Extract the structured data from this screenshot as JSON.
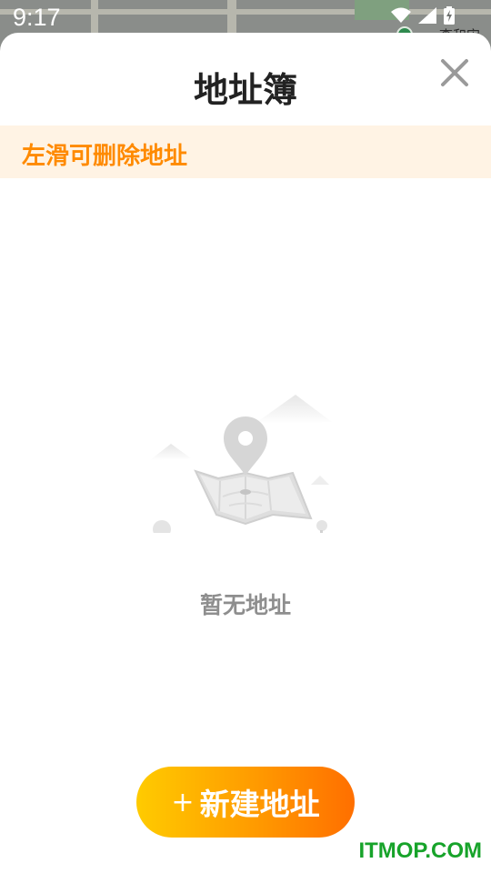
{
  "status_bar": {
    "time": "9:17",
    "icons": [
      "wifi-icon",
      "cellular-signal-icon",
      "battery-charging-icon"
    ]
  },
  "map_backdrop": {
    "label": "李和宋"
  },
  "sheet": {
    "title": "地址簿",
    "close_icon": "close-icon",
    "tip": "左滑可删除地址",
    "empty_state": {
      "icon": "map-location-illustration",
      "text": "暂无地址"
    },
    "new_button": {
      "plus": "+",
      "label": "新建地址"
    }
  },
  "watermark": "ITMOP.COM",
  "colors": {
    "accent_orange": "#ff8a00",
    "tip_background": "#fff3e4",
    "button_gradient_start": "#ffcb00",
    "button_gradient_end": "#ff6f00",
    "watermark_green": "#17a32a"
  }
}
